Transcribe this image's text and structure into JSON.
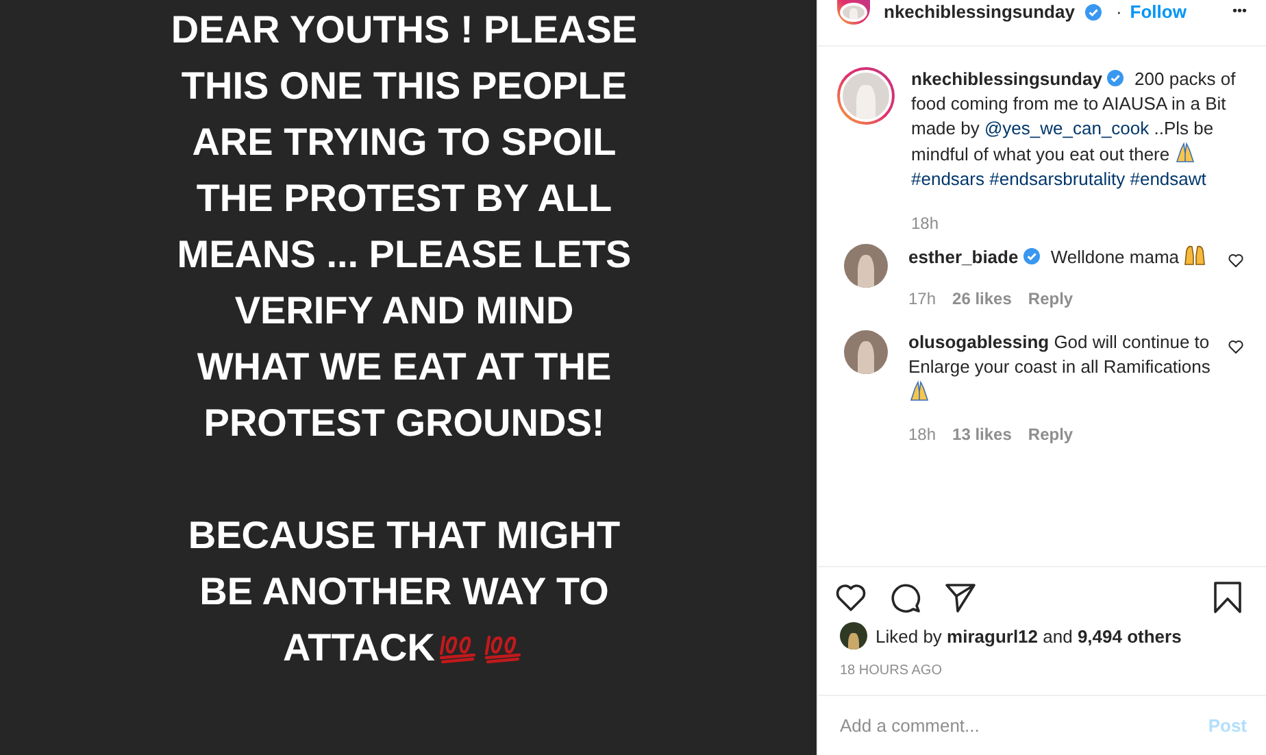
{
  "story": {
    "paragraphs": [
      [
        "DEAR YOUTHS ! PLEASE",
        "THIS ONE THIS PEOPLE",
        "ARE TRYING TO SPOIL",
        "THE PROTEST BY ALL",
        "MEANS ... PLEASE LETS",
        "VERIFY AND MIND",
        "WHAT WE EAT AT THE",
        "PROTEST GROUNDS!"
      ],
      [
        "BECAUSE THAT MIGHT",
        "BE ANOTHER WAY TO",
        "ATTACK"
      ]
    ]
  },
  "header": {
    "username": "nkechiblessingsunday",
    "verified": true,
    "separator": "·",
    "follow": "Follow",
    "more": "•••"
  },
  "caption": {
    "segments": [
      {
        "kind": "user",
        "text": "nkechiblessingsunday"
      },
      {
        "kind": "verified"
      },
      {
        "kind": "text",
        "text": "200 packs of food coming from me to AIAUSA in a Bit made by"
      },
      {
        "kind": "link",
        "text": "@yes_we_can_cook"
      },
      {
        "kind": "text",
        "text": "..Pls be mindful of what you eat out there"
      },
      {
        "kind": "folded-hands"
      },
      {
        "kind": "link",
        "text": "#endsars"
      },
      {
        "kind": "link",
        "text": "#endsarsbrutality"
      },
      {
        "kind": "link",
        "text": "#endsawt"
      }
    ],
    "time": "18h"
  },
  "comments": [
    {
      "username": "esther_biade",
      "verified": true,
      "segments": [
        {
          "kind": "text",
          "text": "Welldone mama"
        },
        {
          "kind": "raised-hands"
        }
      ],
      "time": "17h",
      "likes": "26 likes",
      "reply": "Reply",
      "liked": false
    },
    {
      "username": "olusogablessing",
      "verified": false,
      "segments": [
        {
          "kind": "text",
          "text": "God will continue to Enlarge your coast in all Ramifications"
        },
        {
          "kind": "folded-hands"
        }
      ],
      "time": "18h",
      "likes": "13 likes",
      "reply": "Reply",
      "liked": false
    }
  ],
  "actions": {
    "liked": false,
    "saved": false
  },
  "likes": {
    "prefix": "Liked by",
    "user": "miragurl12",
    "middle": "and",
    "count": "9,494 others"
  },
  "timestamp": "18 HOURS AGO",
  "composer": {
    "placeholder": "Add a comment...",
    "post": "Post",
    "post_disabled": true
  }
}
